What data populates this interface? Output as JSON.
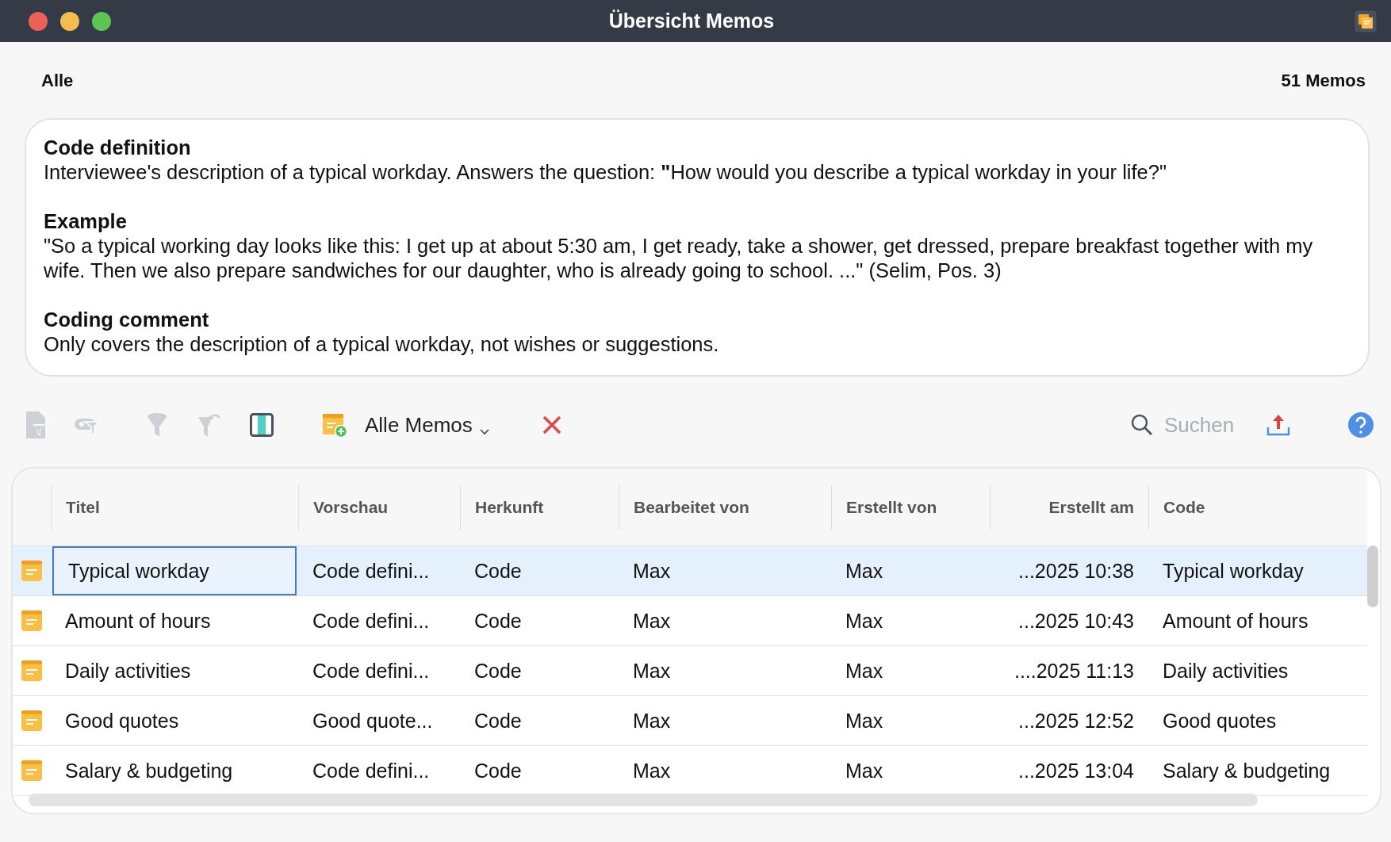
{
  "window": {
    "title": "Übersicht Memos"
  },
  "header": {
    "filter": "Alle",
    "count": "51 Memos"
  },
  "memo": [
    {
      "heading": "Code definition",
      "text": "Interviewee's description of a typical workday. Answers the question: **\"**How would you describe a typical workday in your life?\""
    },
    {
      "heading": "Example",
      "text": "\"So a typical working day looks like this: I get up at about 5:30 am, I get ready, take a shower, get dressed, prepare breakfast together with my wife. Then we also prepare sandwiches for our daughter, who is already going to school. ...\" (Selim, Pos. 3)"
    },
    {
      "heading": "Coding comment",
      "text": "Only covers the description of a typical workday, not wishes or suggestions."
    }
  ],
  "toolbar": {
    "tools": [
      {
        "kind": "doc-filter",
        "disabled": true
      },
      {
        "kind": "link-filter",
        "disabled": true
      },
      {
        "kind": "funnel",
        "disabled": true
      },
      {
        "kind": "funnel-reset",
        "disabled": true
      },
      {
        "kind": "columns",
        "disabled": false
      },
      {
        "kind": "new-memo",
        "disabled": false
      }
    ],
    "dropdown": "Alle Memos",
    "search": {
      "placeholder": "Suchen"
    }
  },
  "table": {
    "columns": [
      "Titel",
      "Vorschau",
      "Herkunft",
      "Bearbeitet von",
      "Erstellt von",
      "Erstellt am",
      "Code"
    ],
    "rows": [
      {
        "selected": true,
        "cells": [
          "Typical workday",
          "Code defini...",
          "Code",
          "Max",
          "Max",
          "...2025 10:38",
          "Typical workday"
        ]
      },
      {
        "selected": false,
        "cells": [
          "Amount of hours",
          "Code defini...",
          "Code",
          "Max",
          "Max",
          "...2025 10:43",
          "Amount of hours"
        ]
      },
      {
        "selected": false,
        "cells": [
          "Daily activities",
          "Code defini...",
          "Code",
          "Max",
          "Max",
          "....2025 11:13",
          "Daily activities"
        ]
      },
      {
        "selected": false,
        "cells": [
          "Good quotes",
          "Good quote...",
          "Code",
          "Max",
          "Max",
          "...2025 12:52",
          "Good quotes"
        ]
      },
      {
        "selected": false,
        "cells": [
          "Salary & budgeting",
          "Code defini...",
          "Code",
          "Max",
          "Max",
          "...2025 13:04",
          "Salary & budgeting"
        ]
      }
    ]
  }
}
